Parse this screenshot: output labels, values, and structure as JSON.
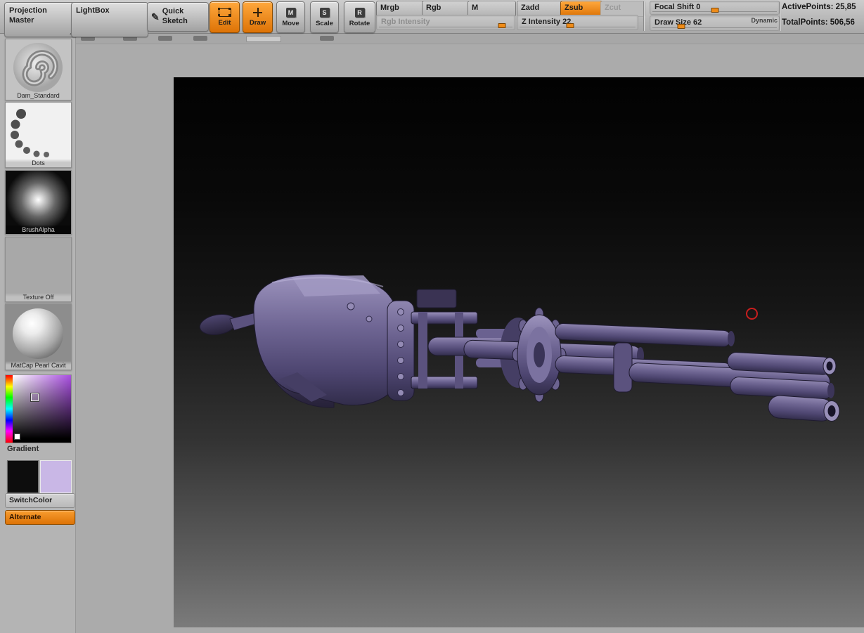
{
  "colors": {
    "accent_orange": "#ee8418",
    "model_purple": "#6f6694",
    "cursor_red": "#c81e1e",
    "canvas_top": "#020202",
    "canvas_bottom": "#7b7b7b"
  },
  "toolbar": {
    "projection_master": "Projection Master",
    "lightbox": "LightBox",
    "quick_sketch": "Quick Sketch",
    "edit": "Edit",
    "draw": "Draw",
    "move": {
      "label": "Move",
      "icon": "M"
    },
    "scale": {
      "label": "Scale",
      "icon": "S"
    },
    "rotate": {
      "label": "Rotate",
      "icon": "R"
    },
    "mrgb": "Mrgb",
    "rgb": "Rgb",
    "m": "M",
    "zadd": "Zadd",
    "zsub": "Zsub",
    "zcut": "Zcut",
    "sliders": {
      "rgb_intensity": {
        "label": "Rgb Intensity"
      },
      "z_intensity": {
        "label": "Z Intensity",
        "value": "22"
      },
      "focal_shift": {
        "label": "Focal Shift",
        "value": "0"
      },
      "draw_size": {
        "label": "Draw Size",
        "value": "62"
      }
    },
    "dynamic": "Dynamic",
    "active_points": "ActivePoints: 25,85",
    "total_points": "TotalPoints: 506,56"
  },
  "sidebar": {
    "brush_label": "Dam_Standard",
    "stroke_label": "Dots",
    "alpha_label": "BrushAlpha",
    "texture_label": "Texture Off",
    "material_label": "MatCap Pearl Cavit",
    "gradient_label": "Gradient",
    "switch_color_label": "SwitchColor",
    "alternate_label": "Alternate",
    "primary_color": "#0d0d0d",
    "secondary_color": "#c9b7e6"
  }
}
